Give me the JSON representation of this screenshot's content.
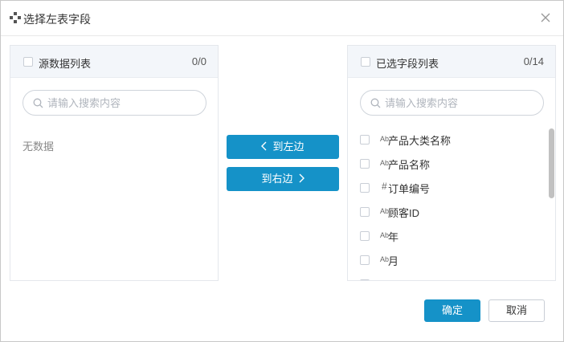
{
  "dialog": {
    "title": "选择左表字段",
    "close_icon": "close-icon",
    "title_icon": "field-select-icon"
  },
  "left_panel": {
    "title": "源数据列表",
    "count": "0/0",
    "search_placeholder": "请输入搜索内容",
    "empty_text": "无数据"
  },
  "right_panel": {
    "title": "已选字段列表",
    "count": "0/14",
    "search_placeholder": "请输入搜索内容",
    "items": [
      {
        "type_icon": "Ab",
        "label": "产品大类名称",
        "checked": false
      },
      {
        "type_icon": "Ab",
        "label": "产品名称",
        "checked": false
      },
      {
        "type_icon": "#",
        "label": "订单编号",
        "checked": false
      },
      {
        "type_icon": "Ab",
        "label": "顾客ID",
        "checked": false
      },
      {
        "type_icon": "Ab",
        "label": "年",
        "checked": false
      },
      {
        "type_icon": "Ab",
        "label": "月",
        "checked": false
      }
    ]
  },
  "transfer": {
    "to_left_label": "到左边",
    "to_right_label": "到右边"
  },
  "footer": {
    "ok_label": "确定",
    "cancel_label": "取消"
  },
  "colors": {
    "primary": "#1592c8",
    "panel_header": "#f3f6fa",
    "border": "#e4e7ec"
  }
}
